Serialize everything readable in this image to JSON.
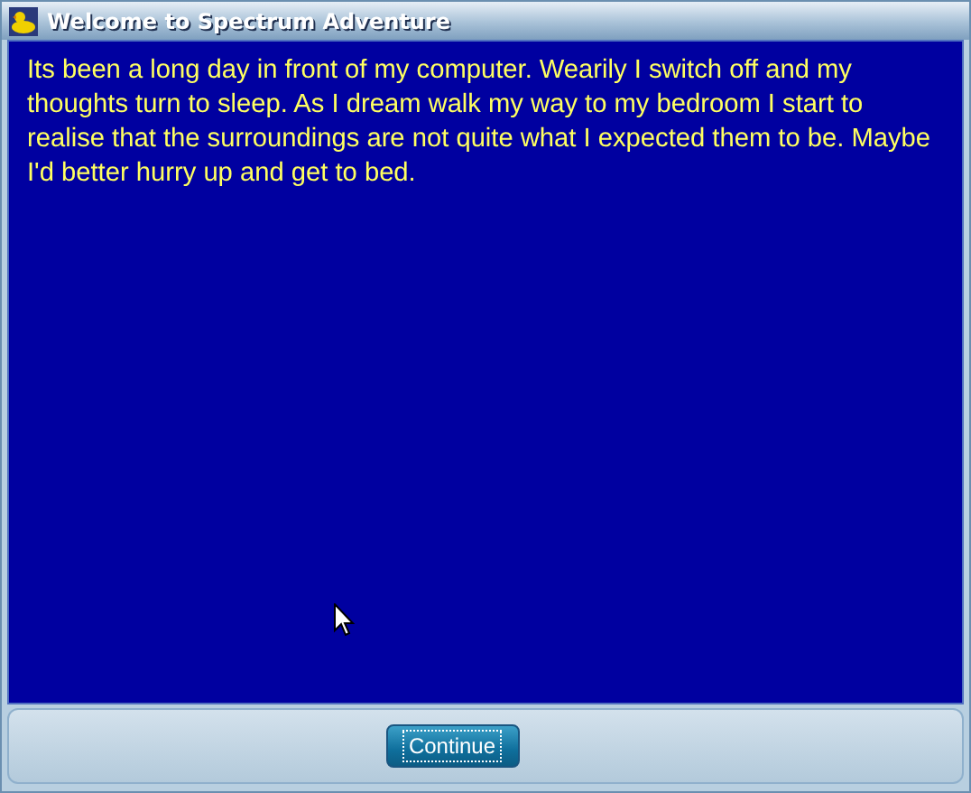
{
  "window": {
    "title": "Welcome to Spectrum Adventure"
  },
  "story": "Its been a long day in front of my computer. Wearily I switch off and my thoughts turn to sleep. As I dream walk my way to my bedroom I start to realise that the surroundings are not quite what I expected them to be. Maybe I'd better hurry up and get to bed.",
  "buttons": [
    {
      "label": "Continue",
      "focused": true
    }
  ]
}
